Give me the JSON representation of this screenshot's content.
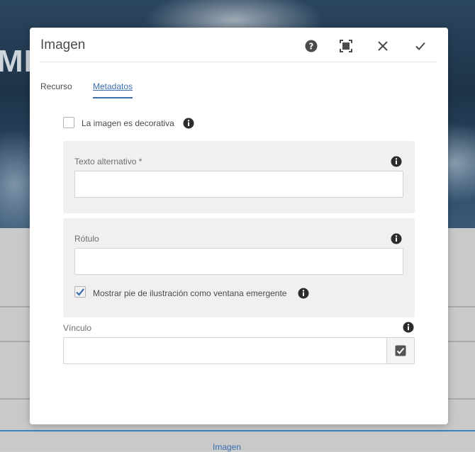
{
  "background": {
    "hero_text": "MI",
    "footer_link": "Imagen"
  },
  "dialog": {
    "title": "Imagen",
    "header_icons": [
      "help-icon",
      "fullscreen-icon",
      "close-icon",
      "check-icon"
    ],
    "tabs": [
      {
        "label": "Recurso",
        "active": false
      },
      {
        "label": "Metadatos",
        "active": true
      }
    ],
    "decorative": {
      "label": "La imagen es decorativa",
      "checked": false
    },
    "alt_text": {
      "label": "Texto alternativo *",
      "value": ""
    },
    "caption": {
      "label": "Rótulo",
      "value": ""
    },
    "popup_caption": {
      "label": "Mostrar pie de ilustración como ventana emergente",
      "checked": true
    },
    "link": {
      "label": "Vínculo",
      "value": ""
    }
  },
  "colors": {
    "accent": "#3a6fb0",
    "panel": "#f0f0f0",
    "check": "#3a6fb0"
  }
}
